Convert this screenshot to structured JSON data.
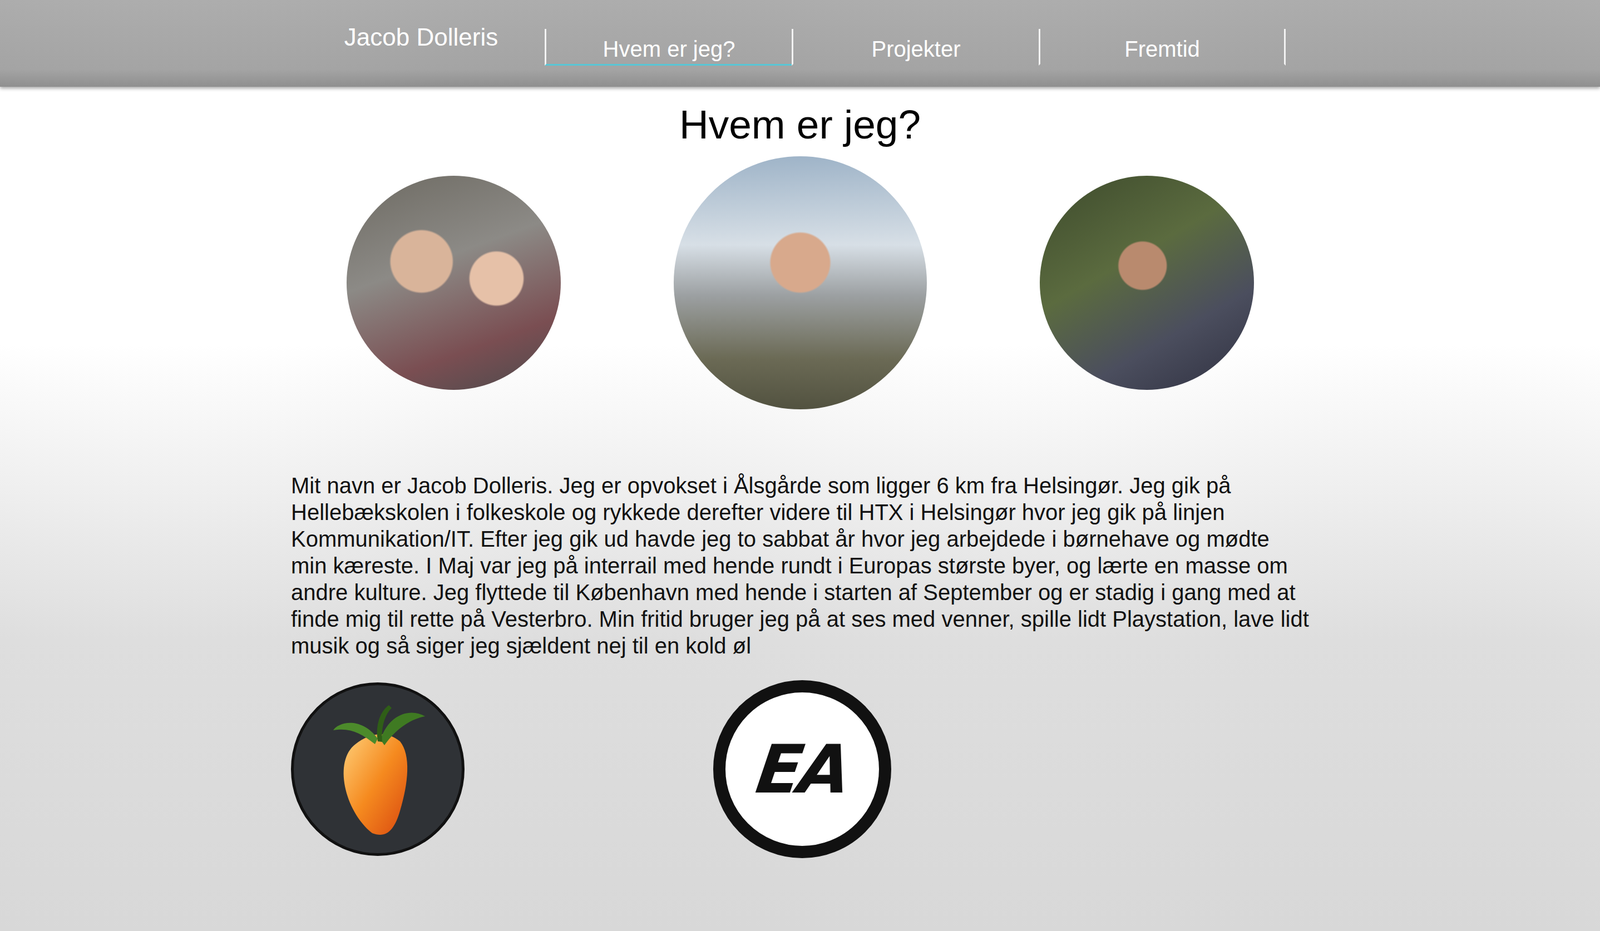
{
  "header": {
    "brand": "Jacob Dolleris",
    "nav": [
      {
        "label": "Hvem er jeg?",
        "selected": true
      },
      {
        "label": "Projekter",
        "selected": false
      },
      {
        "label": "Fremtid",
        "selected": false
      }
    ]
  },
  "page": {
    "heading": "Hvem er jeg?",
    "photos": [
      {
        "kind": "couple"
      },
      {
        "kind": "city"
      },
      {
        "kind": "drink"
      }
    ],
    "paragraph": "Mit navn er Jacob Dolleris. Jeg er opvokset i Ålsgårde som ligger 6 km fra Helsingør. Jeg gik på Hellebækskolen i folkeskole og rykkede derefter videre til HTX i Helsingør hvor jeg gik på linjen Kommunikation/IT. Efter jeg gik ud havde jeg to sabbat år hvor jeg arbejdede i børnehave og mødte min kæreste. I Maj var jeg på interrail med hende rundt i Europas største byer, og lærte en masse om andre kulture. Jeg flyttede til København med hende i starten af September og er stadig i gang med at finde mig til rette på Vesterbro. Min fritid bruger jeg på at ses med venner, spille lidt Playstation, lave lidt musik og så siger jeg sjældent nej til en kold øl",
    "logos": [
      {
        "kind": "fl-studio"
      },
      {
        "kind": "ea",
        "text": "EA"
      }
    ]
  }
}
